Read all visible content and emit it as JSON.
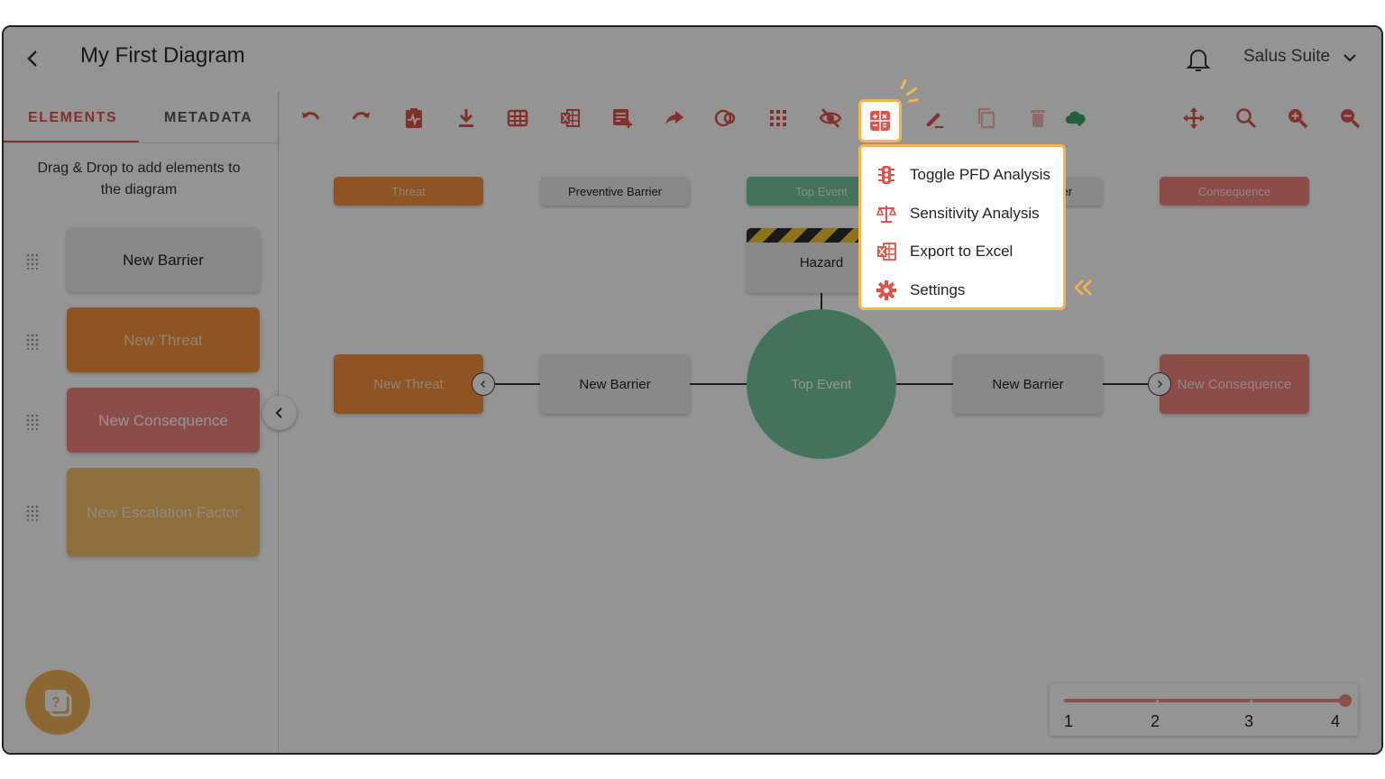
{
  "header": {
    "title": "My First Diagram",
    "account": "Salus Suite"
  },
  "sidebar": {
    "tabs": [
      {
        "label": "ELEMENTS",
        "active": true
      },
      {
        "label": "METADATA",
        "active": false
      }
    ],
    "hint": "Drag & Drop to add elements to the diagram",
    "items": [
      {
        "label": "New Barrier",
        "color": "#ececec",
        "text_color": "#222222"
      },
      {
        "label": "New Threat",
        "color": "#f4923a",
        "text_color": "#fbe5cf"
      },
      {
        "label": "New Consequence",
        "color": "#f28480",
        "text_color": "#ffffff"
      },
      {
        "label": "New Escalation Factor",
        "color": "#f5be68",
        "text_color": "#fbeccd"
      }
    ]
  },
  "toolbar": {
    "icons": [
      "undo-icon",
      "redo-icon",
      "clipboard-pulse-icon",
      "download-icon",
      "table-icon",
      "excel-icon",
      "add-note-icon",
      "share-icon",
      "overlap-circles-icon",
      "grid-icon",
      "eye-off-icon",
      "calculator-icon",
      "edit-icon",
      "copy-icon",
      "delete-icon",
      "cloud-check-icon",
      "move-icon",
      "search-icon",
      "zoom-in-icon",
      "zoom-out-icon"
    ]
  },
  "canvas": {
    "column_headers": [
      {
        "label": "Threat",
        "color": "#f4923a",
        "text_color": "#fde4cc"
      },
      {
        "label": "Preventive Barrier",
        "color": "#ececec",
        "text_color": "#222222"
      },
      {
        "label": "Top Event",
        "color": "#74c69d",
        "text_color": "#e5f6ec"
      },
      {
        "label": "Mitigating Barrier",
        "color": "#ececec",
        "text_color": "#222222"
      },
      {
        "label": "Consequence",
        "color": "#f28480",
        "text_color": "#fde7e6"
      }
    ],
    "hazard": "Hazard",
    "top_event": "Top Event",
    "nodes": [
      {
        "label": "New Threat",
        "color": "#f4923a",
        "text_color": "#fde4cc"
      },
      {
        "label": "New Barrier",
        "color": "#ececec",
        "text_color": "#222222"
      },
      {
        "label": "New Barrier",
        "color": "#ececec",
        "text_color": "#222222"
      },
      {
        "label": "New Consequence",
        "color": "#f28480",
        "text_color": "#fde7e6"
      }
    ]
  },
  "level_slider": {
    "labels": [
      "1",
      "2",
      "3",
      "4"
    ],
    "value": 4
  },
  "dropdown_menu": {
    "items": [
      {
        "label": "Toggle PFD Analysis",
        "icon": "traffic-light-icon"
      },
      {
        "label": "Sensitivity Analysis",
        "icon": "scale-icon"
      },
      {
        "label": "Export to Excel",
        "icon": "excel-icon"
      },
      {
        "label": "Settings",
        "icon": "gear-icon"
      }
    ]
  },
  "colors": {
    "accent": "#e0534a",
    "highlight": "#f6b54b",
    "overlay": "rgba(0,0,0,0.42)"
  }
}
